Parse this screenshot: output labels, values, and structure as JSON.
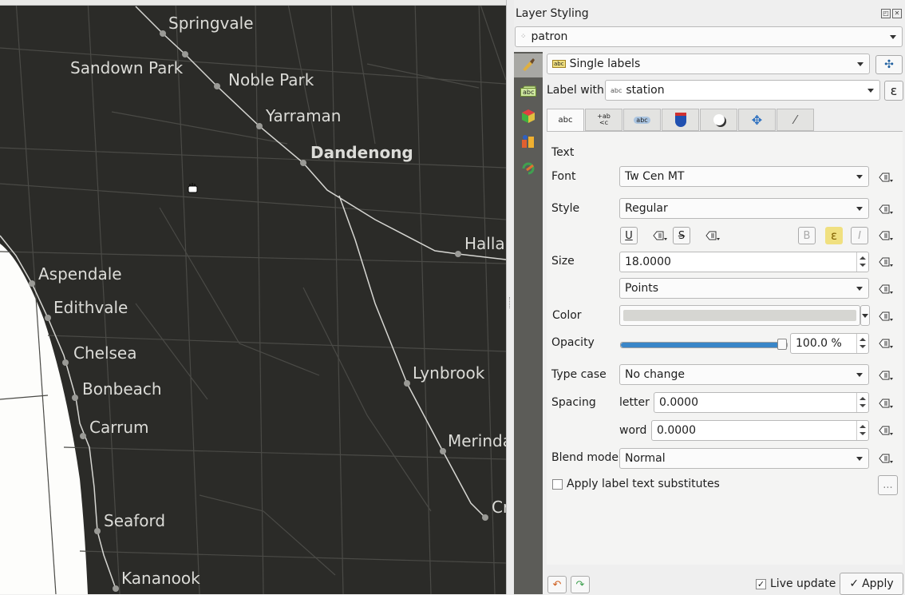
{
  "map": {
    "labels": [
      {
        "text": "Springvale"
      },
      {
        "text": "Sandown Park"
      },
      {
        "text": "Noble Park"
      },
      {
        "text": "Yarraman"
      },
      {
        "text": "Dandenong"
      },
      {
        "text": "Halla"
      },
      {
        "text": "Aspendale"
      },
      {
        "text": "Edithvale"
      },
      {
        "text": "Chelsea"
      },
      {
        "text": "Bonbeach"
      },
      {
        "text": "Carrum"
      },
      {
        "text": "Lynbrook"
      },
      {
        "text": "Merinda"
      },
      {
        "text": "Cr"
      },
      {
        "text": "Seaford"
      },
      {
        "text": "Kananook"
      }
    ],
    "colors": {
      "background": "#2b2b28",
      "roads": "#4a4a46",
      "rail": "#d6d6d2",
      "label": "#dcdcd8",
      "water": "#fdfdfb"
    }
  },
  "panel": {
    "title": "Layer Styling",
    "layer_combo": "patron",
    "renderer_combo": "Single labels",
    "label_with_label": "Label with",
    "label_with_field": "station",
    "expression_btn": "ε",
    "tabs": [
      "abc",
      "+ab <c",
      "abc",
      "",
      "",
      "",
      ""
    ],
    "section": "Text",
    "font_label": "Font",
    "font_value": "Tw Cen MT",
    "style_label": "Style",
    "style_value": "Regular",
    "underline_btn": "U",
    "strike_btn": "S",
    "bold_btn": "B",
    "italic_btn": "I",
    "size_label": "Size",
    "size_value": "18.0000",
    "unit_value": "Points",
    "color_label": "Color",
    "color_value": "#d6d6d2",
    "opacity_label": "Opacity",
    "opacity_value": "100.0 %",
    "opacity_fraction": 1.0,
    "typecase_label": "Type case",
    "typecase_value": "No change",
    "spacing_label": "Spacing",
    "letter_label": "letter",
    "letter_value": "0.0000",
    "word_label": "word",
    "word_value": "0.0000",
    "blend_label": "Blend mode",
    "blend_value": "Normal",
    "substitutes_label": "Apply label text substitutes",
    "substitutes_btn": "...",
    "live_update_label": "Live update",
    "live_update_checked": true,
    "apply_label": "Apply"
  }
}
